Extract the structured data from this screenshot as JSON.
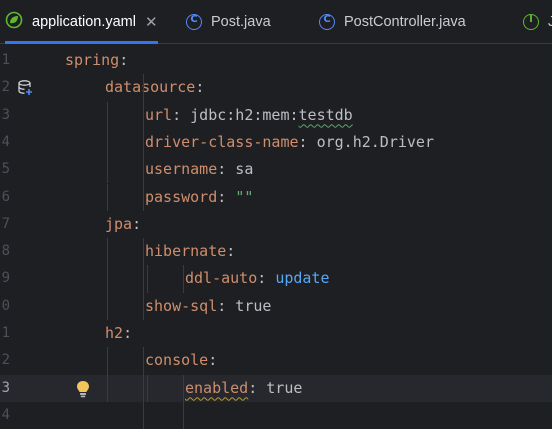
{
  "tabs": [
    {
      "label": "application.yaml",
      "icon": "spring-leaf-icon",
      "active": true,
      "close": "✕"
    },
    {
      "label": "Post.java",
      "icon": "class-icon",
      "active": false
    },
    {
      "label": "PostController.java",
      "icon": "class-icon",
      "active": false
    },
    {
      "label": "J",
      "icon": "interface-icon",
      "active": false
    }
  ],
  "editor": {
    "current_line": 13,
    "lines": [
      {
        "num": "1",
        "indent": 0,
        "tokens": [
          {
            "t": "spring",
            "c": "key"
          },
          {
            "t": ":",
            "c": "plain"
          }
        ]
      },
      {
        "num": "2",
        "indent": 1,
        "gutter_icon": "database-icon",
        "tokens": [
          {
            "t": "datasource",
            "c": "key"
          },
          {
            "t": ":",
            "c": "plain"
          }
        ]
      },
      {
        "num": "3",
        "indent": 2,
        "tokens": [
          {
            "t": "url",
            "c": "key"
          },
          {
            "t": ": jdbc:h2:mem:",
            "c": "plain"
          },
          {
            "t": "testdb",
            "c": "plain",
            "wavy": true
          }
        ]
      },
      {
        "num": "4",
        "indent": 2,
        "tokens": [
          {
            "t": "driver-class-name",
            "c": "key"
          },
          {
            "t": ": org.h2.Driver",
            "c": "plain"
          }
        ]
      },
      {
        "num": "5",
        "indent": 2,
        "tokens": [
          {
            "t": "username",
            "c": "key"
          },
          {
            "t": ": sa",
            "c": "plain"
          }
        ]
      },
      {
        "num": "6",
        "indent": 2,
        "tokens": [
          {
            "t": "password",
            "c": "key"
          },
          {
            "t": ": ",
            "c": "plain"
          },
          {
            "t": "\"\"",
            "c": "str"
          }
        ]
      },
      {
        "num": "7",
        "indent": 1,
        "tokens": [
          {
            "t": "jpa",
            "c": "key"
          },
          {
            "t": ":",
            "c": "plain"
          }
        ]
      },
      {
        "num": "8",
        "indent": 2,
        "tokens": [
          {
            "t": "hibernate",
            "c": "key"
          },
          {
            "t": ":",
            "c": "plain"
          }
        ]
      },
      {
        "num": "9",
        "indent": 3,
        "tokens": [
          {
            "t": "ddl-auto",
            "c": "key"
          },
          {
            "t": ": ",
            "c": "plain"
          },
          {
            "t": "update",
            "c": "kw"
          }
        ]
      },
      {
        "num": "0",
        "indent": 2,
        "tokens": [
          {
            "t": "show-sql",
            "c": "key"
          },
          {
            "t": ": true",
            "c": "plain"
          }
        ]
      },
      {
        "num": "1",
        "indent": 1,
        "tokens": [
          {
            "t": "h2",
            "c": "key"
          },
          {
            "t": ":",
            "c": "plain"
          }
        ]
      },
      {
        "num": "2",
        "indent": 2,
        "tokens": [
          {
            "t": "console",
            "c": "key"
          },
          {
            "t": ":",
            "c": "plain"
          }
        ]
      },
      {
        "num": "3",
        "indent": 3,
        "gutter_icon": "lightbulb-icon",
        "tokens": [
          {
            "t": "enabled",
            "c": "key",
            "wavy_y": true
          },
          {
            "t": ": true",
            "c": "plain"
          }
        ]
      },
      {
        "num": "4",
        "indent": 0,
        "tokens": []
      }
    ]
  },
  "colors": {
    "background": "#1e1f22",
    "key": "#cf8e6d",
    "value": "#bcbec4",
    "string": "#6aab73",
    "keyword": "#56a8f5",
    "tab_underline": "#3574f0"
  }
}
